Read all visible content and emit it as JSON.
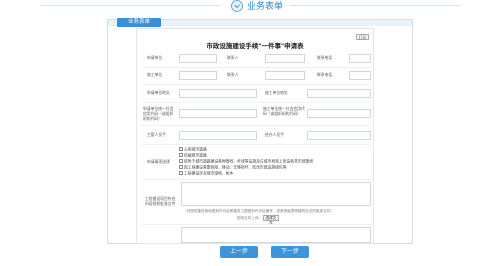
{
  "header": {
    "title": "业务表单"
  },
  "panel": {
    "tab_label": "业务表单"
  },
  "form": {
    "title": "市政设施建设手续\"一件事\"申请表",
    "print_label": "打印",
    "row1": [
      "申请单位",
      "联系人",
      "联系电话"
    ],
    "row2": [
      "施工单位",
      "联系人",
      "联系电话"
    ],
    "row3": [
      "申请单位地址",
      "施工单位地址"
    ],
    "row4": [
      "申请单位统一社会信用代码（或组织机构代码）",
      "施工单位统一社会信用代码（或组织机构代码）"
    ],
    "row5": [
      "主管人员手",
      "经办人员手"
    ],
    "matters_label": "申请事项选择",
    "options": [
      "占用城市道路",
      "挖掘城市道路",
      "依附于城市道路建设各种管线、杆线等设施及在城市桥梁上架设各类市政管线",
      "因工程建设需要拆除、移动、迁移损坏、砍伐市政设施绿化等",
      "工程建设涉及城市绿地、树木"
    ],
    "file_label": "工程建设项目符合市容规划批准文件",
    "file_hint": "（可提供建设用地规划许可证和建设工程规划许可证编号，或其他能表明建筑合法的批准文件）",
    "file_hint2": "规划文件上传：",
    "select_file_label": "选择文件"
  },
  "nav": {
    "prev_label": "上一步",
    "next_label": "下一步"
  }
}
